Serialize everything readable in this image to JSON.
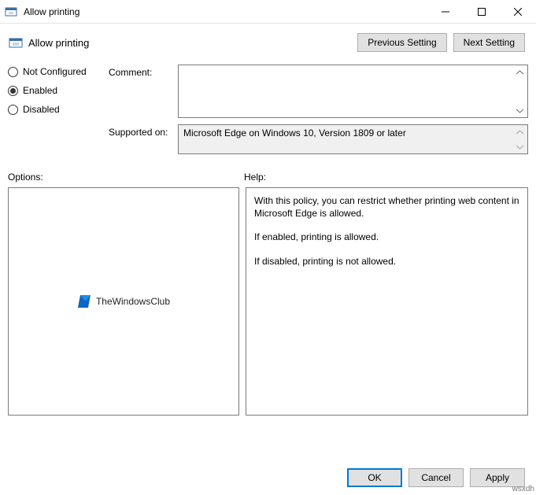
{
  "window": {
    "title": "Allow printing"
  },
  "header": {
    "title": "Allow printing"
  },
  "nav": {
    "prev": "Previous Setting",
    "next": "Next Setting"
  },
  "state": {
    "not_configured": "Not Configured",
    "enabled": "Enabled",
    "disabled": "Disabled",
    "selected": "enabled"
  },
  "fields": {
    "comment_label": "Comment:",
    "comment_value": "",
    "supported_label": "Supported on:",
    "supported_value": "Microsoft Edge on Windows 10, Version 1809 or later"
  },
  "sections": {
    "options_label": "Options:",
    "help_label": "Help:"
  },
  "help": {
    "p1": "With this policy, you can restrict whether printing web content in Microsoft Edge is allowed.",
    "p2": "If enabled, printing is allowed.",
    "p3": "If disabled, printing is not allowed."
  },
  "watermark": {
    "text": "TheWindowsClub"
  },
  "footer": {
    "ok": "OK",
    "cancel": "Cancel",
    "apply": "Apply"
  },
  "corner": {
    "text": "wsxdh"
  }
}
